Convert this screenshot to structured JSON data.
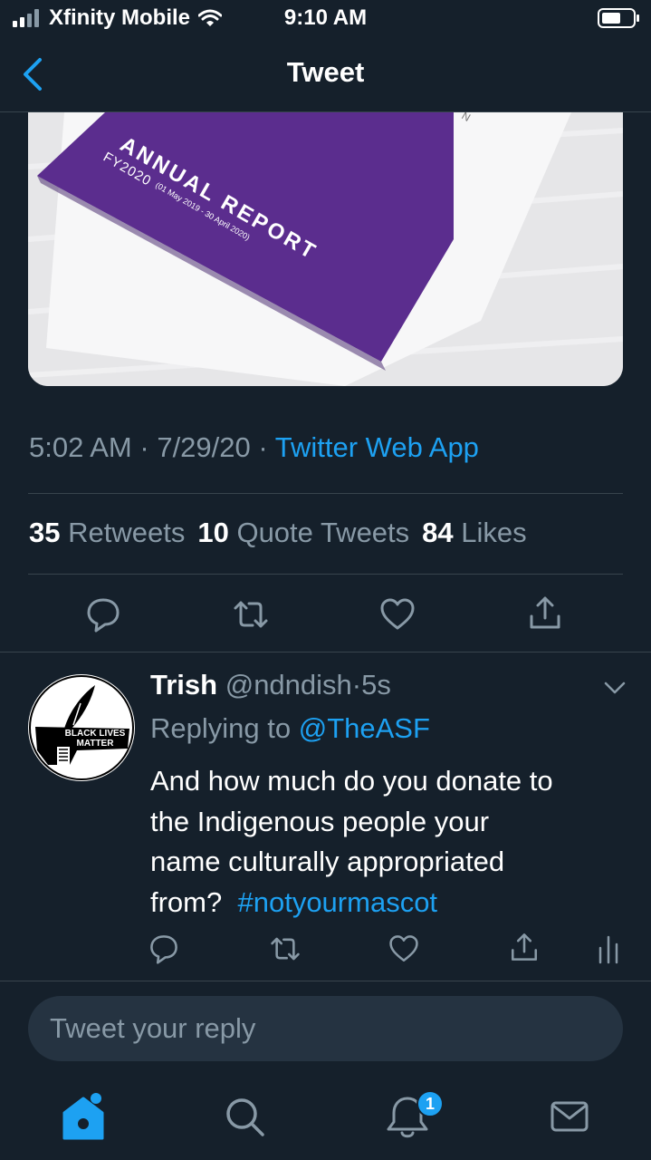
{
  "status_bar": {
    "carrier": "Xfinity Mobile",
    "time": "9:10 AM",
    "icons": [
      "signal-icon",
      "wifi-icon",
      "battery-icon"
    ]
  },
  "header": {
    "title": "Tweet",
    "back_icon": "chevron-left-icon"
  },
  "media": {
    "image_text_title": "ANNUAL REPORT",
    "image_text_sub": "FY2020",
    "image_text_range": "(01 May 2019 - 30 April 2020)",
    "image_text_corner": "N",
    "accent_color": "#5b2d8e"
  },
  "tweet": {
    "time": "5:02 AM",
    "date": "7/29/20",
    "source": "Twitter Web App",
    "separator": "·",
    "retweets_count": "35",
    "retweets_label": "Retweets",
    "quotes_count": "10",
    "quotes_label": "Quote Tweets",
    "likes_count": "84",
    "likes_label": "Likes"
  },
  "reply": {
    "name": "Trish",
    "handle": "@ndndish",
    "age": "5s",
    "replying_label": "Replying to",
    "replying_to": "@TheASF",
    "text_line1": "And how much do you donate to",
    "text_line2": "the Indigenous people your",
    "text_line3": "name culturally appropriated",
    "text_line4": "from?",
    "hashtag": "#notyourmascot",
    "avatar_text_1": "BLACK LIVES",
    "avatar_text_2": "MATTER"
  },
  "compose": {
    "placeholder": "Tweet your reply"
  },
  "tabs": {
    "home": "home-icon",
    "search": "search-icon",
    "notifications": "bell-icon",
    "messages": "mail-icon",
    "notifications_badge": "1"
  },
  "colors": {
    "background": "#15202b",
    "accent": "#1da1f2",
    "secondary_text": "#8899a6",
    "divider": "#38444d"
  }
}
